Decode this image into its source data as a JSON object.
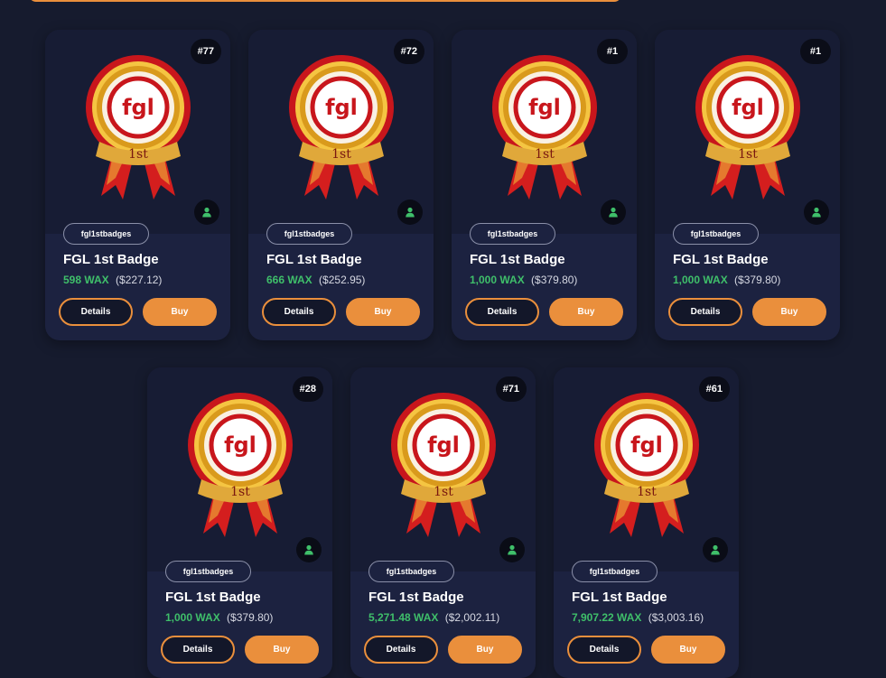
{
  "colors": {
    "background": "#161b2e",
    "card": "#1c2240",
    "accent": "#ea8f3c",
    "wax_green": "#3fbf6a"
  },
  "icons": {
    "owner": "user-icon",
    "art": "fgl-1st-badge-ribbon"
  },
  "buttons": {
    "details": "Details",
    "buy": "Buy"
  },
  "cards": [
    {
      "mint": "#77",
      "collection": "fgl1stbadges",
      "name": "FGL 1st Badge",
      "wax": "598 WAX",
      "usd": "($227.12)"
    },
    {
      "mint": "#72",
      "collection": "fgl1stbadges",
      "name": "FGL 1st Badge",
      "wax": "666 WAX",
      "usd": "($252.95)"
    },
    {
      "mint": "#1",
      "collection": "fgl1stbadges",
      "name": "FGL 1st Badge",
      "wax": "1,000 WAX",
      "usd": "($379.80)"
    },
    {
      "mint": "#1",
      "collection": "fgl1stbadges",
      "name": "FGL 1st Badge",
      "wax": "1,000 WAX",
      "usd": "($379.80)"
    },
    {
      "mint": "#28",
      "collection": "fgl1stbadges",
      "name": "FGL 1st Badge",
      "wax": "1,000 WAX",
      "usd": "($379.80)"
    },
    {
      "mint": "#71",
      "collection": "fgl1stbadges",
      "name": "FGL 1st Badge",
      "wax": "5,271.48 WAX",
      "usd": "($2,002.11)"
    },
    {
      "mint": "#61",
      "collection": "fgl1stbadges",
      "name": "FGL 1st Badge",
      "wax": "7,907.22 WAX",
      "usd": "($3,003.16)"
    }
  ]
}
